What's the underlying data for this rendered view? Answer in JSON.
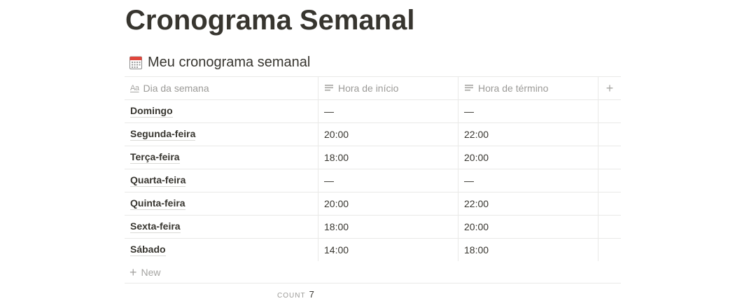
{
  "page": {
    "title": "Cronograma Semanal"
  },
  "database": {
    "icon": "calendar-icon",
    "title": "Meu cronograma semanal",
    "columns": [
      {
        "label": "Dia da semana",
        "icon": "title-aa-icon"
      },
      {
        "label": "Hora de início",
        "icon": "text-lines-icon"
      },
      {
        "label": "Hora de término",
        "icon": "text-lines-icon"
      }
    ],
    "add_column_label": "+",
    "rows": [
      {
        "day": "Domingo",
        "start": "—",
        "end": "—"
      },
      {
        "day": "Segunda-feira",
        "start": "20:00",
        "end": "22:00"
      },
      {
        "day": "Terça-feira",
        "start": "18:00",
        "end": "20:00"
      },
      {
        "day": "Quarta-feira",
        "start": "—",
        "end": "—"
      },
      {
        "day": "Quinta-feira",
        "start": "20:00",
        "end": "22:00"
      },
      {
        "day": "Sexta-feira",
        "start": "18:00",
        "end": "20:00"
      },
      {
        "day": "Sábado",
        "start": "14:00",
        "end": "18:00"
      }
    ],
    "new_label": "New",
    "count_label": "COUNT",
    "count_value": "7"
  },
  "colors": {
    "text": "#37352f",
    "muted": "#9b9a97",
    "border": "#e9e9e7"
  }
}
